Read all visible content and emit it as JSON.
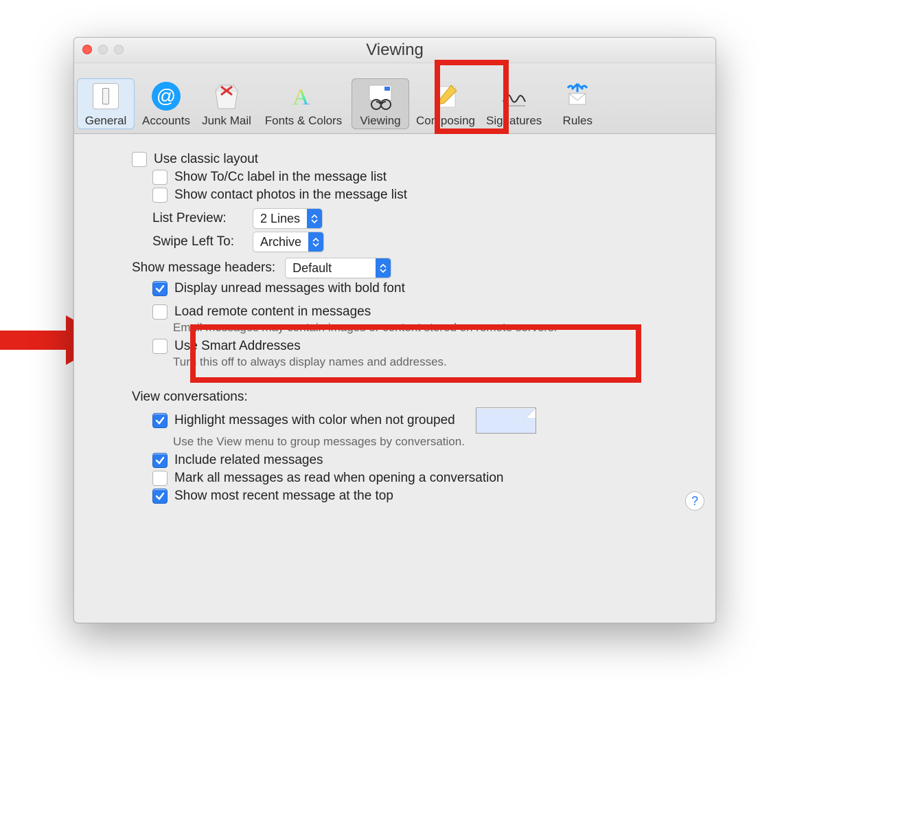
{
  "window": {
    "title": "Viewing"
  },
  "toolbar": {
    "items": [
      {
        "name": "general",
        "label": "General"
      },
      {
        "name": "accounts",
        "label": "Accounts"
      },
      {
        "name": "junk",
        "label": "Junk Mail"
      },
      {
        "name": "fonts",
        "label": "Fonts & Colors"
      },
      {
        "name": "viewing",
        "label": "Viewing"
      },
      {
        "name": "composing",
        "label": "Composing"
      },
      {
        "name": "signatures",
        "label": "Signatures"
      },
      {
        "name": "rules",
        "label": "Rules"
      }
    ]
  },
  "options": {
    "classic_layout": {
      "label": "Use classic layout",
      "checked": false
    },
    "show_tocc": {
      "label": "Show To/Cc label in the message list",
      "checked": false
    },
    "show_contact_photos": {
      "label": "Show contact photos in the message list",
      "checked": false
    },
    "list_preview_label": "List Preview:",
    "list_preview_value": "2 Lines",
    "swipe_left_label": "Swipe Left To:",
    "swipe_left_value": "Archive",
    "headers_label": "Show message headers:",
    "headers_value": "Default",
    "bold_unread": {
      "label": "Display unread messages with bold font",
      "checked": true
    },
    "load_remote": {
      "label": "Load remote content in messages",
      "checked": false,
      "sub": "Email messages may contain images or content stored on remote servers."
    },
    "smart_addresses": {
      "label": "Use Smart Addresses",
      "checked": false,
      "sub": "Turn this off to always display names and addresses."
    },
    "conversations_header": "View conversations:",
    "highlight": {
      "label": "Highlight messages with color when not grouped",
      "checked": true,
      "sub": "Use the View menu to group messages by conversation."
    },
    "include_related": {
      "label": "Include related messages",
      "checked": true
    },
    "mark_read": {
      "label": "Mark all messages as read when opening a conversation",
      "checked": false
    },
    "recent_top": {
      "label": "Show most recent message at the top",
      "checked": true
    }
  },
  "help": "?"
}
